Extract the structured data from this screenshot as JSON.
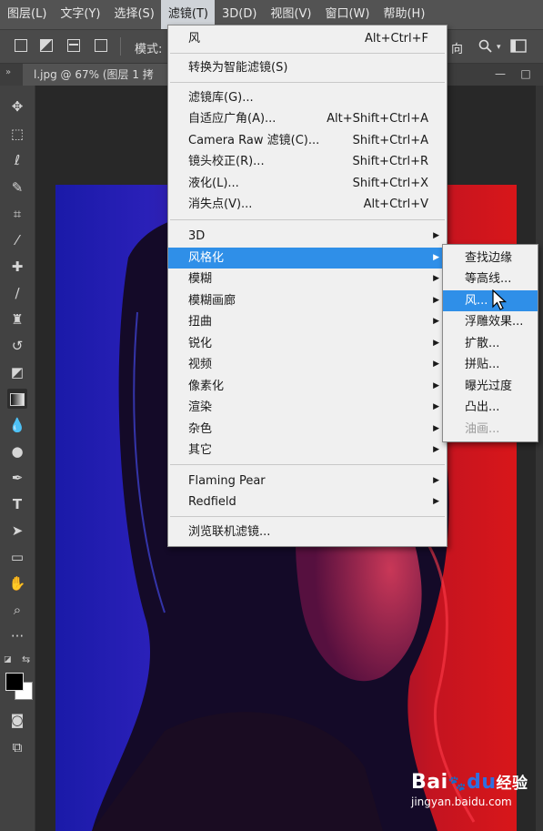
{
  "menubar": {
    "items": [
      {
        "label": "图层(L)"
      },
      {
        "label": "文字(Y)"
      },
      {
        "label": "选择(S)"
      },
      {
        "label": "滤镜(T)"
      },
      {
        "label": "3D(D)"
      },
      {
        "label": "视图(V)"
      },
      {
        "label": "窗口(W)"
      },
      {
        "label": "帮助(H)"
      }
    ],
    "active_index": 3
  },
  "options": {
    "mode_label": "模式:",
    "direction_partial": "向"
  },
  "document_tab": {
    "label": "l.jpg @ 67% (图层 1 拷"
  },
  "filter_menu": {
    "items": [
      {
        "label": "风",
        "shortcut": "Alt+Ctrl+F"
      },
      {
        "label": "转换为智能滤镜(S)",
        "shortcut": ""
      },
      {
        "label": "滤镜库(G)...",
        "shortcut": ""
      },
      {
        "label": "自适应广角(A)...",
        "shortcut": "Alt+Shift+Ctrl+A"
      },
      {
        "label": "Camera Raw 滤镜(C)...",
        "shortcut": "Shift+Ctrl+A"
      },
      {
        "label": "镜头校正(R)...",
        "shortcut": "Shift+Ctrl+R"
      },
      {
        "label": "液化(L)...",
        "shortcut": "Shift+Ctrl+X"
      },
      {
        "label": "消失点(V)...",
        "shortcut": "Alt+Ctrl+V"
      },
      {
        "label": "3D",
        "submenu": true
      },
      {
        "label": "风格化",
        "submenu": true,
        "highlighted": true
      },
      {
        "label": "模糊",
        "submenu": true
      },
      {
        "label": "模糊画廊",
        "submenu": true
      },
      {
        "label": "扭曲",
        "submenu": true
      },
      {
        "label": "锐化",
        "submenu": true
      },
      {
        "label": "视频",
        "submenu": true
      },
      {
        "label": "像素化",
        "submenu": true
      },
      {
        "label": "渲染",
        "submenu": true
      },
      {
        "label": "杂色",
        "submenu": true
      },
      {
        "label": "其它",
        "submenu": true
      },
      {
        "label": "Flaming Pear",
        "submenu": true
      },
      {
        "label": "Redfield",
        "submenu": true
      },
      {
        "label": "浏览联机滤镜...",
        "shortcut": ""
      }
    ]
  },
  "stylize_submenu": {
    "items": [
      {
        "label": "查找边缘"
      },
      {
        "label": "等高线..."
      },
      {
        "label": "风...",
        "highlighted": true
      },
      {
        "label": "浮雕效果..."
      },
      {
        "label": "扩散..."
      },
      {
        "label": "拼贴..."
      },
      {
        "label": "曝光过度"
      },
      {
        "label": "凸出..."
      },
      {
        "label": "油画...",
        "disabled": true
      }
    ]
  },
  "watermark": {
    "logo_a": "Bai",
    "logo_b": "du",
    "logo_c": "经验",
    "url": "jingyan.baidu.com"
  },
  "colors": {
    "highlight": "#2f8fe8",
    "menu_bg": "#f0f0f0",
    "ui_dark": "#535353"
  }
}
